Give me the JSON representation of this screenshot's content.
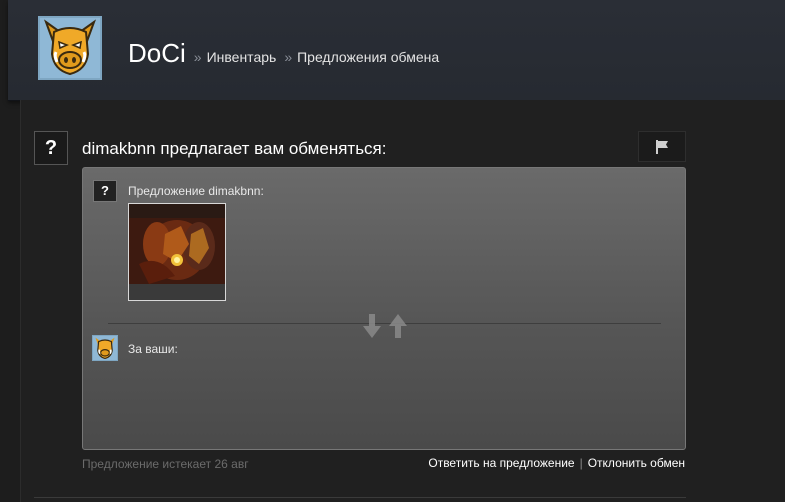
{
  "header": {
    "persona_name": "DoCi",
    "breadcrumb_sep": "»",
    "breadcrumbs": [
      "Инвентарь",
      "Предложения обмена"
    ],
    "avatar_icon": "boar-icon"
  },
  "offer": {
    "heading": "dimakbnn предлагает вам обменяться:",
    "unknown_avatar_symbol": "?",
    "flag_icon": "flag-icon",
    "their_label": "Предложение dimakbnn:",
    "their_items_count": 1,
    "your_label": "За ваши:",
    "swap_icon": "swap-arrows-icon",
    "expiry_text": "Предложение истекает 26 авг",
    "respond_label": "Ответить на предложение",
    "action_separator": "|",
    "decline_label": "Отклонить обмен"
  },
  "colors": {
    "page_bg": "#1d1d1d",
    "header_bg": "#2a2e36",
    "trade_box_top": "#6a6a6a",
    "trade_box_bottom": "#4a4a4a",
    "avatar_bg": "#8fb8d6"
  }
}
